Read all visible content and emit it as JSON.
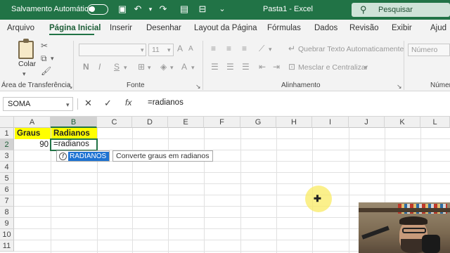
{
  "titlebar": {
    "autosave_label": "Salvamento Automático",
    "doc_title": "Pasta1  -  Excel",
    "search_placeholder": "Pesquisar"
  },
  "tabs": [
    "Arquivo",
    "Página Inicial",
    "Inserir",
    "Desenhar",
    "Layout da Página",
    "Fórmulas",
    "Dados",
    "Revisão",
    "Exibir",
    "Ajud"
  ],
  "ribbon": {
    "paste_label": "Colar",
    "font_size": "11",
    "bold": "N",
    "italic": "I",
    "underline": "S",
    "wrap_text": "Quebrar Texto Automaticamente",
    "merge_center": "Mesclar e Centralizar",
    "number_format": "Número",
    "groups": {
      "clipboard": "Área de Transferência",
      "font": "Fonte",
      "alignment": "Alinhamento",
      "number": "Númer"
    }
  },
  "formula_bar": {
    "name_box": "SOMA",
    "cancel": "✕",
    "enter": "✓",
    "fx": "fx",
    "formula": "=radianos"
  },
  "sheet": {
    "columns": [
      "A",
      "B",
      "C",
      "D",
      "E",
      "F",
      "G",
      "H",
      "I",
      "J",
      "K",
      "L"
    ],
    "rows": [
      "1",
      "2",
      "3",
      "4",
      "5",
      "6",
      "7",
      "8",
      "9",
      "10",
      "11"
    ],
    "A1": "Graus",
    "B1": "Radianos",
    "A2": "90",
    "B2": "=radianos"
  },
  "autocomplete": {
    "function_name": "RADIANOS",
    "description": "Converte graus em radianos"
  },
  "colors": {
    "excel_green": "#217346",
    "header_fill": "#ffff00",
    "autocomplete_highlight": "#1e73d2"
  }
}
